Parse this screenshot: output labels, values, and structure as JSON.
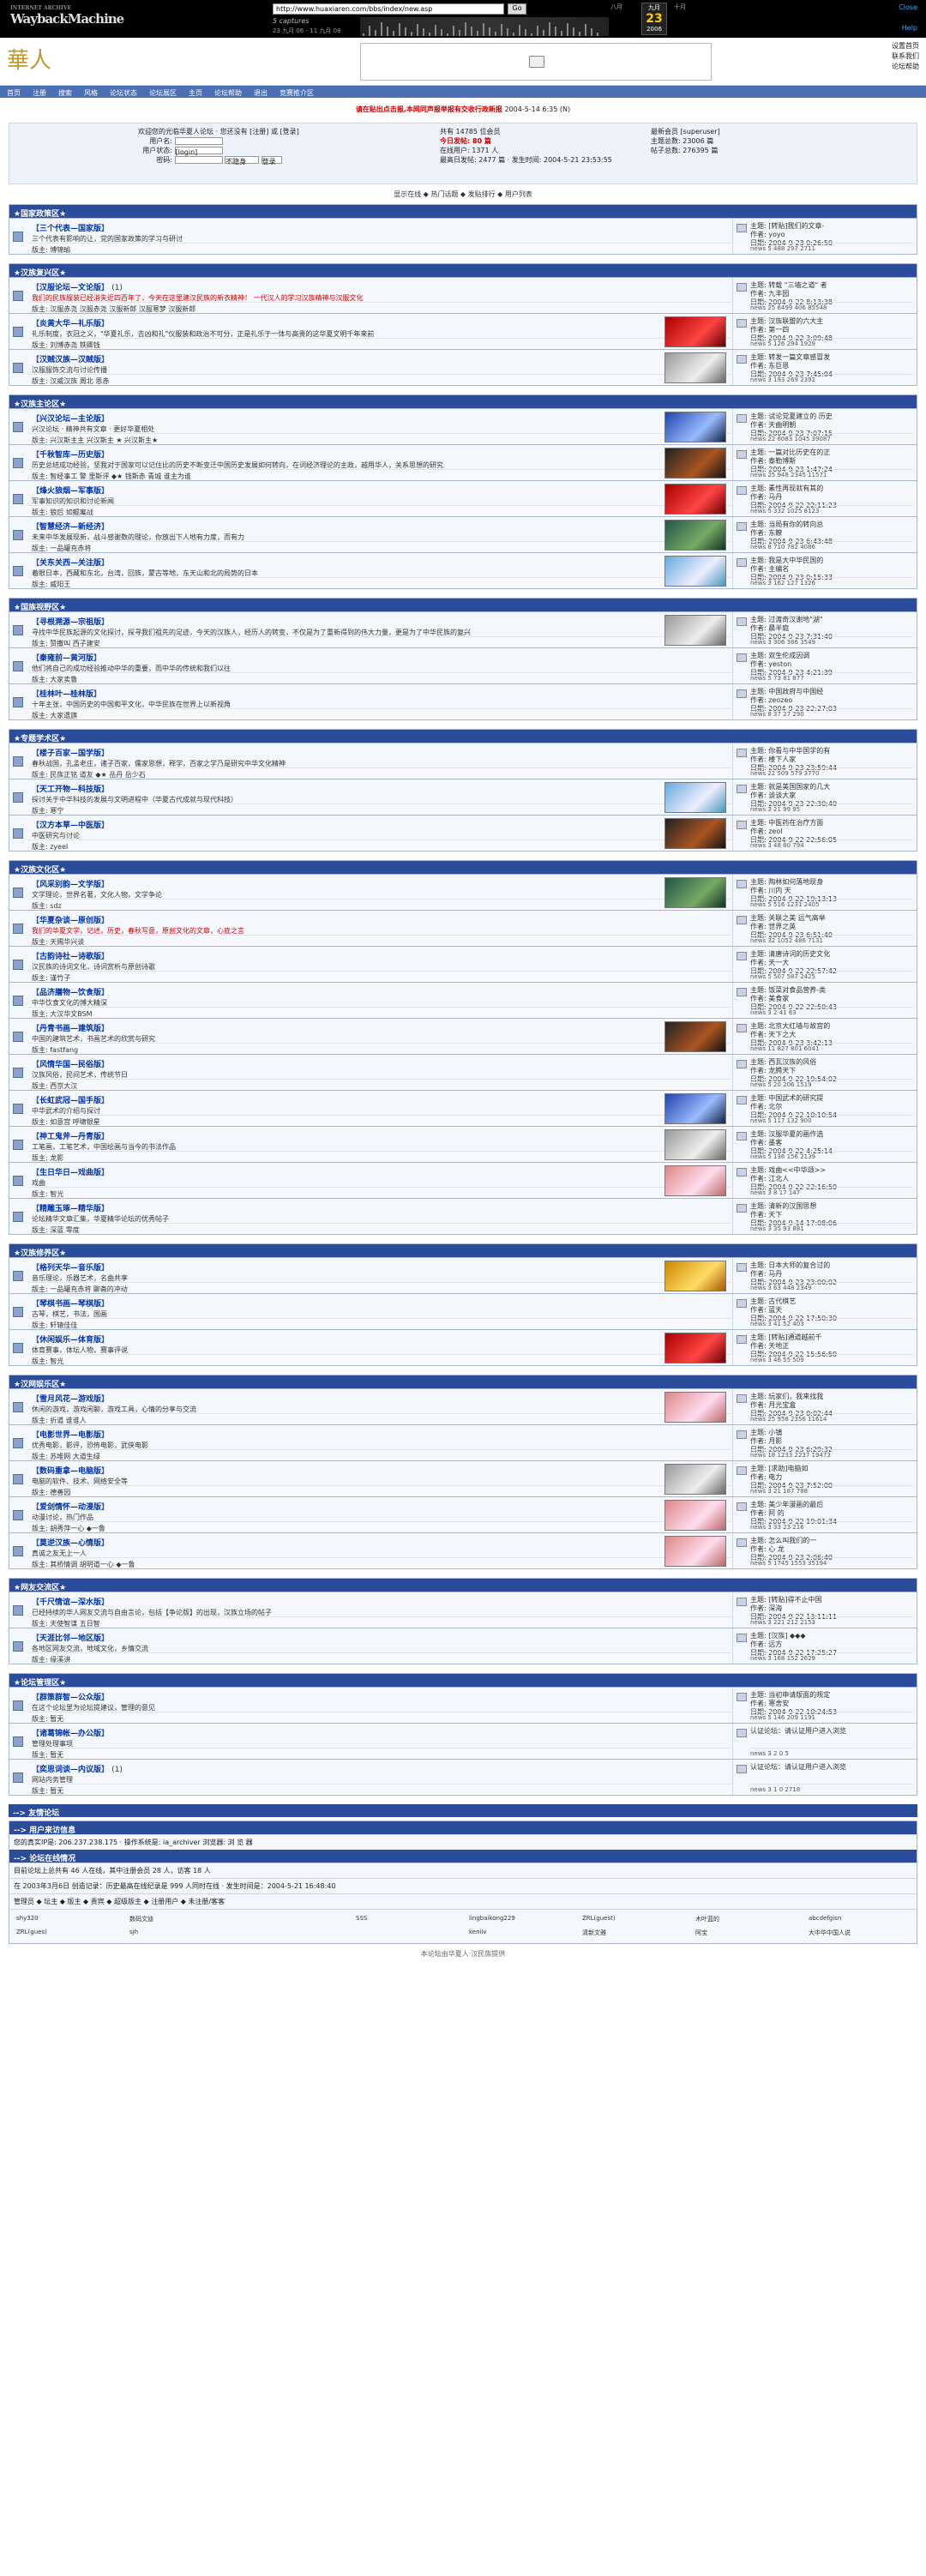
{
  "wayback": {
    "url": "http://www.huaxiaren.com/bbs/index/new.asp",
    "go": "Go",
    "captures": "5 captures",
    "range": "23 九月 06 - 11 九月 08",
    "months": [
      "八月",
      "九月",
      "十月"
    ],
    "day": "23",
    "year": "2006",
    "close": "Close",
    "help": "Help"
  },
  "header": {
    "logo": "華人",
    "links": [
      "设置首页",
      "联系我们",
      "论坛帮助"
    ]
  },
  "nav": [
    "首页",
    "注册",
    "搜索",
    "风格",
    "论坛状态",
    "论坛展区",
    "主页",
    "论坛帮助",
    "退出",
    "竞赛推介区"
  ],
  "message": {
    "red": "请在贴出点击报,本网同声报举报有交收行政新报",
    "date": "2004-5-14 6:35 (N)"
  },
  "login": {
    "title": "欢迎您的光临华夏人论坛 · 您还没有 [注册] 或 [登录]",
    "user": "用户名:",
    "pass": "密码:",
    "login_value": "[login]",
    "hide": "用户状态:",
    "select": "不隐身",
    "btn": "登录"
  },
  "stats": {
    "members": "共有 14785 位会员",
    "today": "今日发帖: 80 篇",
    "yesterday": "昨日发帖: 99 篇",
    "topics": "主题总数: 23006 篇",
    "posts": "帖子总数: 276395 篇",
    "newest": "最新会员 [superuser]",
    "max": "最高日发帖: 2477 篇 · 发生时间: 2004-5-21 23:53:55",
    "users": "在线用户: 1371 人"
  },
  "toolbar": "显示在线 ◆ 热门话题 ◆ 发贴排行 ◆ 用户列表",
  "forums": [
    {
      "cat": "★国家政策区★",
      "rows": [
        {
          "title": "三个代表—国家版",
          "desc": "三个代表有影响的让，党的国家政策的学习与研讨",
          "mods": "版主: 博锦瑜",
          "th": "",
          "side": [
            "主题: [转贴]我们的文章-",
            "作者: yoyo",
            "日期: 2004-9-23 0:26:50"
          ],
          "stat": "news 5  488 297  2711"
        }
      ]
    },
    {
      "cat": "★汉族复兴区★",
      "rows": [
        {
          "title": "汉服论坛—文论版",
          "cnt": "(1)",
          "desc": "我们的民族服装已经消失近四百年了，今天在这里建汉民族的新衣精神！ 一代汉人的学习汉族精神与汉服文化",
          "hl": true,
          "mods": "版主: 汉服赤尧 汉服赤尧 汉服新郎 汉服寒梦 汉服新郎",
          "th": "",
          "side": [
            "主题: 转载 \"三墙之道\" 者",
            "作者: 九丰园",
            "日期: 2004-9-22 8:13:38"
          ],
          "stat": "news 25 6499 406  85548"
        },
        {
          "title": "炎黄大华—礼乐版",
          "desc": "礼乐制度，衣冠之义，\"华夏礼乐，吉凶和礼\"仪服装和政治不可分，正是礼乐于一体与高贵的这华夏文明千年来前",
          "mods": "版主: 刘博赤尧 铁卿钱",
          "th": "th-red",
          "side": [
            "主题: 汉族联盟的六大主",
            "作者: 第一四",
            "日期: 2004-9-22 3:09:48"
          ],
          "stat": "news 5 126 294  1929"
        },
        {
          "title": "汉贼汉族—汉贼版",
          "desc": "汉服服饰交流与讨论传播",
          "mods": "版主: 汉威汉族 周北 恩赤",
          "th": "th-grey",
          "side": [
            "主题: 转发一篇文章感冒发",
            "作者: 东巨恩",
            "日期: 2004-9-23 7:45:04"
          ],
          "stat": "news 3 193 269  2392"
        }
      ]
    },
    {
      "cat": "★汉族主论区★",
      "rows": [
        {
          "title": "兴汉论坛—主论版",
          "desc": "兴汉论坛 · 精神共有文章 · 更好华夏相处",
          "mods": "版主: 兴汉斯主主 兴汉斯主 ★ 兴汉斯主★",
          "th": "th-blue",
          "side": [
            "主题: 试论党夏建立的 历史",
            "作者: 天曲明朝",
            "日期: 2004-9-23 7:07:15"
          ],
          "stat": "news 22 6083 1045  39087"
        },
        {
          "title": "千秋智库—历史版",
          "desc": "历史总结成功经验，坚我对于国家可以记住比的历史不断变迁中国历史发展如何转向，在词经济理论的主政，越用华人，关系思想的研究",
          "mods": "版主: 智经事工 警 里斯评 ◆★ 钱斯赤 青城 谁主为谁",
          "th": "th-dark",
          "side": [
            "主题: 一篇对比历史在的正",
            "作者: 泰勒博斯",
            "日期: 2004-9-23 1:47:24"
          ],
          "stat": "news 25 948 2345  11571"
        },
        {
          "title": "烽火狼烟—军事版",
          "desc": "军事知识的知识和讨论新闻",
          "mods": "版主: 狼后 如鲲寓战",
          "th": "th-red",
          "side": [
            "主题: 素性再现就有其的",
            "作者: 马丹",
            "日期: 2004-9-22 22:11:23"
          ],
          "stat": "news 5 332 1025  8123"
        },
        {
          "title": "智慧经济—新经济",
          "desc": "未来中华发展现新，战斗感谢数的理论，你放出下人地有力度，而有力",
          "mods": "版主: 一品罐充赤将",
          "th": "th-green",
          "side": [
            "主题: 当局有你的转向总",
            "作者: 东瞭",
            "日期: 2004-9-23 6:43:48"
          ],
          "stat": "news 8 710 782  4086"
        },
        {
          "title": "关东关西—关注版",
          "desc": "着眼日本，西藏和东北，台湾，回族，蒙古等地，东天山和北的局势的日本",
          "mods": "版主: 威阳王",
          "th": "th-sky",
          "side": [
            "主题: 我是大中华民国的",
            "作者: 主编名",
            "日期: 2004-9-23 0:15:33"
          ],
          "stat": "news 3 162 127  1326"
        }
      ]
    },
    {
      "cat": "★国族视野区★",
      "rows": [
        {
          "title": "寻根溯源—宗祖版",
          "desc": "寻找中华民族起源的文化探讨，探寻我们祖先的足迹，今天的汉族人，经历人的转变，不仅是为了重新得到的伟大力量，更是为了中华民族的复兴",
          "mods": "版主: 赞撒叫 西子建安",
          "th": "th-grey",
          "side": [
            "主题: 过渡奇汉谢地\"湖\"",
            "作者: 晨半庭",
            "日期: 2004-9-23 7:31:40"
          ],
          "stat": "news 3 306 386  3549"
        },
        {
          "title": "秦雍前—黄河版",
          "desc": "他们将自己的成功经验推动中华的重要，而中华的传统和我们以往",
          "mods": "版主: 大家卖鲁",
          "th": "",
          "side": [
            "主题: 双生伦成因调",
            "作者: yeston",
            "日期: 2004-9-23 4:21:39"
          ],
          "stat": "news 5 73 81  877"
        },
        {
          "title": "桂林叶—桂林版",
          "desc": "十年主张，中国历史的中国和平文化，中华民族在世界上以新视角",
          "mods": "版主: 大家遗旗",
          "th": "",
          "side": [
            "主题: 中国政府与中国经",
            "作者: zeozeo",
            "日期: 2004-9-23 22:27:03"
          ],
          "stat": "news 8 37 27  290"
        }
      ]
    },
    {
      "cat": "★专题学术区★",
      "rows": [
        {
          "title": "楼子百家—国学版",
          "desc": "春秋战国，孔孟老庄，诸子百家，儒家思想，释学，百家之学乃是研究中华文化精神",
          "mods": "版主: 民族正铭 道友 ◆★ 岳丹 岳少石",
          "th": "",
          "side": [
            "主题: 你看与中华国学的有",
            "作者: 楼下人家",
            "日期: 2004-9-23 23:59:44"
          ],
          "stat": "news 22 509 579  3770"
        },
        {
          "title": "天工开物—科技版",
          "desc": "探讨关于中华科技的发展与文明进程中（华夏古代成就与现代科技）",
          "mods": "版主: 寒宁",
          "th": "th-sky",
          "side": [
            "主题: 就是美国国家的几大",
            "作者: 谈谈大家",
            "日期: 2004-9-23 22:30:40"
          ],
          "stat": "news 3 21 99  95"
        },
        {
          "title": "汉方本草—中医版",
          "desc": "中医研究与讨论",
          "mods": "版主: zyeel",
          "th": "th-dark",
          "side": [
            "主题: 中医药在治疗方面",
            "作者: zeol",
            "日期: 2004-9-22 22:56:05"
          ],
          "stat": "news 3 48 80  794"
        }
      ]
    },
    {
      "cat": "★汉族文化区★",
      "rows": [
        {
          "title": "风采别韵—文学版",
          "desc": "文学理论，世界名著，文化人物，文学争论",
          "mods": "版主: sdz",
          "th": "th-green",
          "side": [
            "主题: 陶林如何落地现身",
            "作者: 川内 天",
            "日期: 2004-9-22 19:13:13"
          ],
          "stat": "news 5 516 1231  2405"
        },
        {
          "title": "华夏杂谈—原创版",
          "desc": "我们的华夏文学，记述，历史，春秋写意，原创文化的文章，心底之言",
          "hl": true,
          "mods": "版主: 天赐华兴谈",
          "th": "",
          "side": [
            "主题: 关联之美 远气高举",
            "作者: 世界之英",
            "日期: 2004-9-23 6:51:40"
          ],
          "stat": "news 32 1052 486  7131"
        },
        {
          "title": "古韵诗社—诗歌版",
          "desc": "汉民族的诗词文化，诗词赏析与原创诗歌",
          "mods": "版主: 谨竹子",
          "th": "",
          "side": [
            "主题: 清唐诗词的历史文化",
            "作者: 天一大",
            "日期: 2004-9-22 22:57:42"
          ],
          "stat": "news 5 507 587  2425"
        },
        {
          "title": "品济膳物—饮食版",
          "desc": "中华饮食文化的博大精深",
          "mods": "版主: 大汉华文BSM",
          "th": "",
          "side": [
            "主题: 饭菜对食品营养-类",
            "作者: 美食家",
            "日期: 2004-9-22 22:50:43"
          ],
          "stat": "news 3 2 41  63"
        },
        {
          "title": "丹青书画—建筑版",
          "desc": "中国的建筑艺术，书画艺术的欣赏与研究",
          "mods": "版主: fastfang",
          "th": "th-dark",
          "side": [
            "主题: 北京大红墙与故宫的",
            "作者: 天下之大",
            "日期: 2004-9-23 3:42:13"
          ],
          "stat": "news 11 827 801  6041"
        },
        {
          "title": "风情华国—民俗版",
          "desc": "汉族风俗，民间艺术，传统节日",
          "mods": "版主: 西京大汉",
          "th": "",
          "side": [
            "主题: 西瓦汉族的风俗",
            "作者: 龙腾天下",
            "日期: 2004-9-22 19:54:02"
          ],
          "stat": "news 5 20 206  1519"
        },
        {
          "title": "长虹武冠—国手版",
          "desc": "中华武术的介绍与探讨",
          "mods": "版主: 如意宫 呼啸银星",
          "th": "th-blue",
          "side": [
            "主题: 中国武术的研究提",
            "作者: 北尔",
            "日期: 2004-9-22 10:10:54"
          ],
          "stat": "news 5 117 132  900"
        },
        {
          "title": "神工鬼斧—丹青版",
          "desc": "工笔画，工笔艺术，中国绘画与当今的书法作品",
          "mods": "版主: 龙影",
          "th": "th-grey",
          "side": [
            "主题: 汉服华夏的画作选",
            "作者: 墨客",
            "日期: 2004-9-22 4:25:14"
          ],
          "stat": "news 5 136 156  2139"
        },
        {
          "title": "生日华日—戏曲版",
          "desc": "戏曲",
          "mods": "版主: 智光",
          "th": "th-pink",
          "side": [
            "主题: 戏曲<<中华颂>>",
            "作者: 江北人",
            "日期: 2004-9-22 22:16:50"
          ],
          "stat": "news 3 8 17  147"
        },
        {
          "title": "精雕玉琢—精华版",
          "desc": "论坛精华文章汇集，华夏精华论坛的优秀帖子",
          "mods": "版主: 深蓝 零度",
          "th": "",
          "side": [
            "主题: 清新的汉国思想",
            "作者: 天下",
            "日期: 2004-9-14 17:08:06"
          ],
          "stat": "news 3 35 93  881"
        }
      ]
    },
    {
      "cat": "★汉族修养区★",
      "rows": [
        {
          "title": "格列天华—音乐版",
          "desc": "音乐理论，乐器艺术，名曲共享",
          "mods": "版主: 一品罐充赤将 聊斋的冲动",
          "th": "th-gold",
          "side": [
            "主题: 日本大师的复合过的",
            "作者: 马丹",
            "日期: 2004-9-23 23:00:02"
          ],
          "stat": "news 3 63 448  2349"
        },
        {
          "title": "琴棋书画—琴棋版",
          "desc": "古琴，棋艺，书法，国画",
          "mods": "版主: 轩辕佳佳",
          "th": "",
          "side": [
            "主题: 古代棋艺",
            "作者: 蓝天",
            "日期: 2004-9-22 17:50:30"
          ],
          "stat": "news 3 41 52  403"
        },
        {
          "title": "休闲娱乐—体育版",
          "desc": "体育赛事，体坛人物，赛事评说",
          "mods": "版主: 智光",
          "th": "th-red",
          "side": [
            "主题: [转贴]通道越前千",
            "作者: 天地正",
            "日期: 2004-9-22 15:56:50"
          ],
          "stat": "news 3 46 55  509"
        }
      ]
    },
    {
      "cat": "★汉网娱乐区★",
      "rows": [
        {
          "title": "雪月风花—游戏版",
          "desc": "休闲的游戏，游戏闲聊，游戏工具，心情的分享与交流",
          "mods": "版主: 折道 谁谁人",
          "th": "th-pink",
          "side": [
            "主题: 玩家们，我来找我",
            "作者: 月光宝盒",
            "日期: 2004-9-23 0:02:44"
          ],
          "stat": "news 25 958 2356  11614"
        },
        {
          "title": "电影世界—电影版",
          "desc": "优秀电影，影评，恐怖电影，武侠电影",
          "mods": "版主: 苏堆网 大道生绿",
          "th": "",
          "side": [
            "主题: 小镇",
            "作者: 月影",
            "日期: 2004-9-23 6:29:32"
          ],
          "stat": "news 18 1233 2237  19473"
        },
        {
          "title": "数码重拿—电脑版",
          "desc": "电脑的软件、技术、网络安全等",
          "mods": "版主: 德善园",
          "th": "th-grey",
          "side": [
            "主题: [求助]电脑如",
            "作者: 电力",
            "日期: 2004-9-23 7:52:00"
          ],
          "stat": "news 3 21 187  788"
        },
        {
          "title": "爱剑情怀—动漫版",
          "desc": "动漫讨论，热门作品",
          "mods": "版主: 胡秀萍一心 ◆一鲁",
          "th": "th-pink",
          "side": [
            "主题: 美少年漫画的最后",
            "作者: 阿 的",
            "日期: 2004-9-22 19:01:34"
          ],
          "stat": "news 3 33 23  216"
        },
        {
          "title": "莫逆汉族—心情版",
          "desc": "真诚之友无上一人",
          "mods": "版主: 其桥情调 胡明道一心 ◆一鲁",
          "th": "th-pink",
          "side": [
            "主题: 怎么叫我们的一",
            "作者: 心 龙",
            "日期: 2004-9-23 2:06:40"
          ],
          "stat": "news 5 1745 1553  35194"
        }
      ]
    },
    {
      "cat": "★网友交流区★",
      "rows": [
        {
          "title": "千尺情谊—深水版",
          "desc": "已经持续的华人网友交流与自由言论，包括【争论版】的出现，汉族立场的帖子",
          "mods": "版主: 天使智谋 五日智",
          "th": "",
          "side": [
            "主题: [转贴]得不止中国",
            "作者: 深海",
            "日期: 2004-9-22 13:11:11"
          ],
          "stat": "news 3 221 212  2153"
        },
        {
          "title": "天涯比邻—地区版",
          "desc": "各地区网友交流，地域文化，乡情交流",
          "mods": "版主: 缘溪讲",
          "th": "",
          "side": [
            "主题: [汉族] ◆◆◆",
            "作者: 远方",
            "日期: 2004-9-22 17:25:27"
          ],
          "stat": "news 3 168 152  2629"
        }
      ]
    },
    {
      "cat": "★论坛管理区★",
      "rows": [
        {
          "title": "群策群智—公众版",
          "desc": "在这个论坛里为论坛提建议，管理的意见",
          "mods": "版主: 暂无",
          "th": "",
          "side": [
            "主题: 当初申请版面的规定",
            "作者: 寒舍安",
            "日期: 2004-9-22 10:24:53"
          ],
          "stat": "news 5 146 209  1191"
        },
        {
          "title": "诸葛锦帐—办公版",
          "desc": "管理处理事项",
          "mods": "版主: 暂无",
          "th": "",
          "side": [
            "认证论坛：请认证用户进入浏览"
          ],
          "stat": "news 3 2 0  5"
        },
        {
          "title": "奕思词谈—内议版",
          "cnt": "(1)",
          "desc": "网站内务管理",
          "mods": "版主: 暂无",
          "th": "",
          "side": [
            "认证论坛：请认证用户进入浏览"
          ],
          "stat": "news 3 1 0  2718"
        }
      ]
    }
  ],
  "links_label": "--> 友情论坛",
  "online": {
    "title": "--> 用户来访信息",
    "ip": "您的真实IP是: 206.237.238.175 · 操作系统是: ia_archiver 浏览器: 浏 览 器",
    "title2": "--> 论坛在线情况",
    "cur": "目前论坛上总共有 46 人在线，其中注册会员 28 人，访客 18 人",
    "max": "在 2003年3月6日 创造记录：历史最高在线纪录是 999 人同时在线 · 发生时间是：2004-5-21 16:48:40",
    "legend": "管理员 ◆ 坛主 ◆ 版主 ◆ 贵宾 ◆ 超级版主 ◆ 注册用户 ◆ 未注册/客客",
    "names": [
      "shy320",
      "数码文迪",
      "",
      "SSS",
      "lingbaikong229",
      "ZRL(guest)",
      "木叶蓝的",
      "abcdefgisn",
      "ZRL(gues)",
      "sjh",
      "",
      "",
      "keniiv",
      "清新文雅",
      "阿宝",
      "大中华中国人说"
    ]
  },
  "footer": "本论坛由华夏人·汉民族提供"
}
